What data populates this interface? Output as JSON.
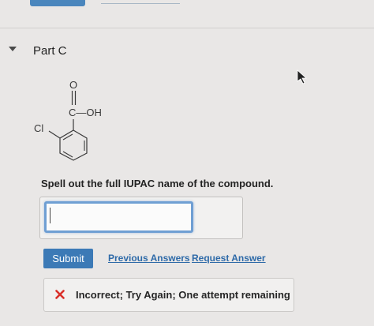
{
  "part": {
    "title": "Part C",
    "toggle_icon": "caret-down-icon"
  },
  "molecule": {
    "carbonyl_oxygen": "O",
    "carboxyl_label": "C—OH",
    "substituent": "Cl"
  },
  "question": {
    "prompt": "Spell out the full IUPAC name of the compound.",
    "answer_value": ""
  },
  "actions": {
    "submit_label": "Submit",
    "previous_answers_label": "Previous Answers",
    "request_answer_label": "Request Answer"
  },
  "feedback": {
    "icon": "x-icon",
    "message": "Incorrect; Try Again; One attempt remaining"
  },
  "colors": {
    "accent": "#3c7ab6",
    "link": "#2e6aa8",
    "error": "#d9302a",
    "input_focus": "#6f9fd3"
  }
}
